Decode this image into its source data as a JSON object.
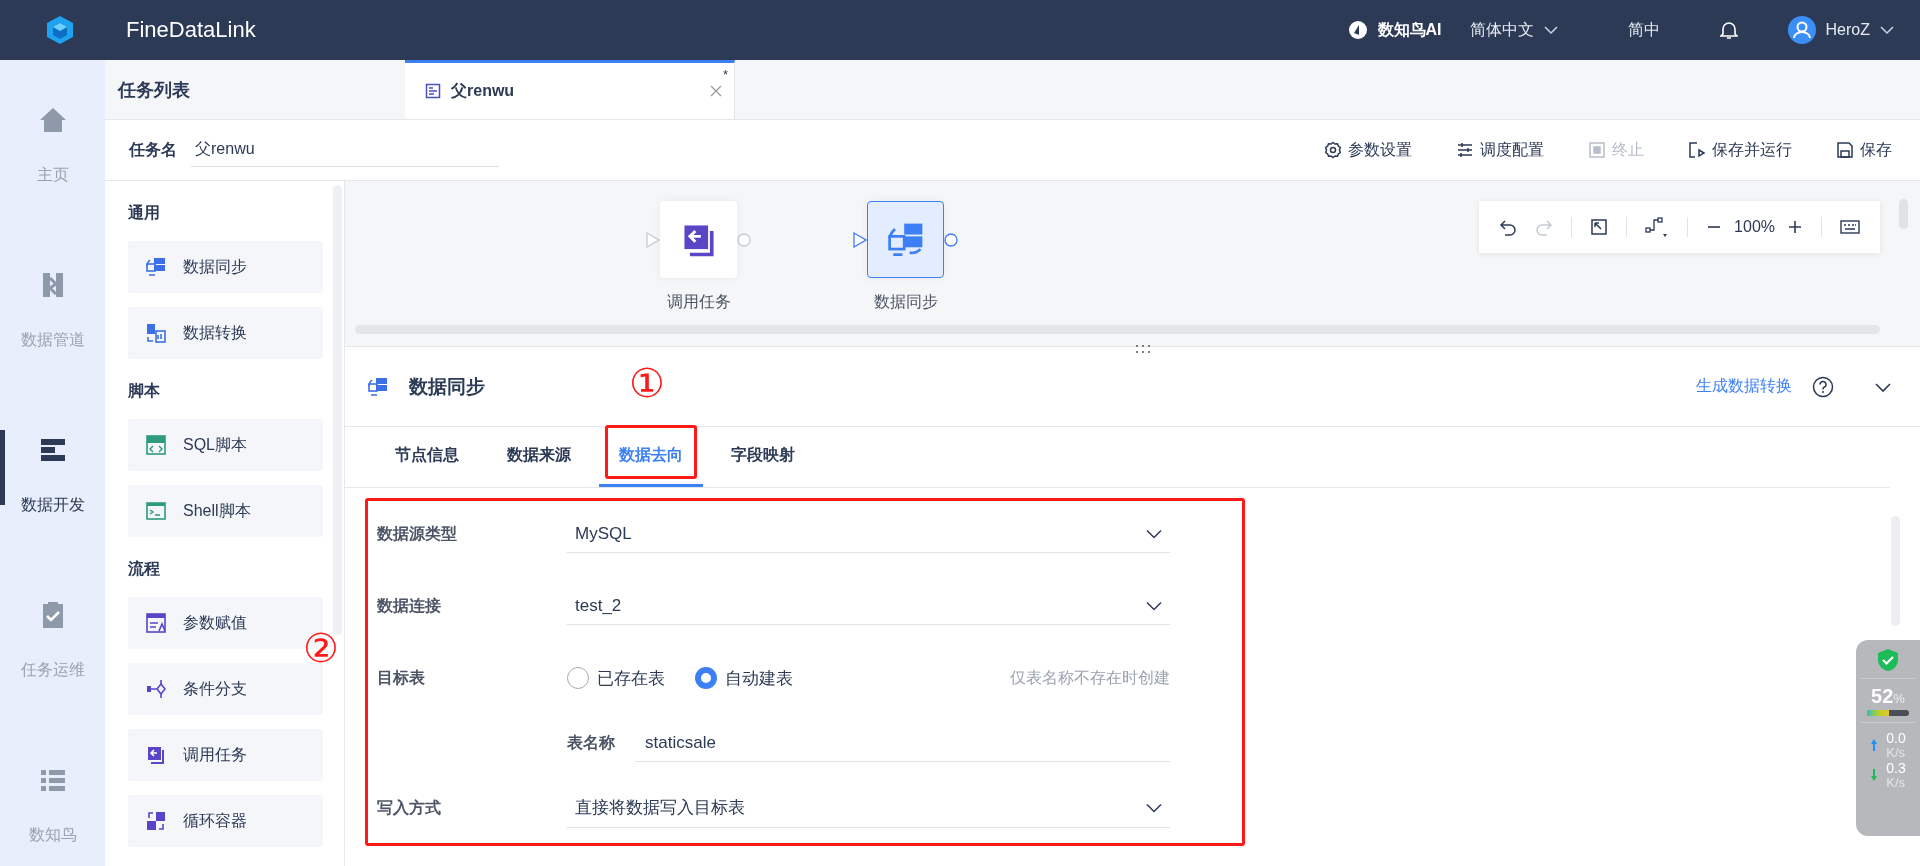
{
  "header": {
    "brand": "FineDataLink",
    "ai_label": "数知鸟AI",
    "language": "简体中文",
    "short_language": "简中",
    "user": "HeroZ"
  },
  "nav": [
    {
      "label": "主页",
      "kind": "home",
      "selected": false
    },
    {
      "label": "数据管道",
      "kind": "pipe",
      "selected": false
    },
    {
      "label": "数据开发",
      "kind": "dev",
      "selected": true
    },
    {
      "label": "任务运维",
      "kind": "ops",
      "selected": false
    },
    {
      "label": "数知鸟",
      "kind": "list",
      "selected": false
    }
  ],
  "task_list_title": "任务列表",
  "tabs": [
    {
      "label": "父renwu",
      "modified": "*",
      "selected": true
    }
  ],
  "task_name": {
    "label": "任务名",
    "value": "父renwu"
  },
  "toolbar": [
    {
      "label": "参数设置",
      "kind": "gear",
      "disabled": false
    },
    {
      "label": "调度配置",
      "kind": "sliders",
      "disabled": false
    },
    {
      "label": "终止",
      "kind": "stop",
      "disabled": true
    },
    {
      "label": "保存并运行",
      "kind": "run",
      "disabled": false
    },
    {
      "label": "保存",
      "kind": "save",
      "disabled": false
    }
  ],
  "palette": [
    {
      "group": "通用",
      "items": [
        {
          "label": "数据同步",
          "kind": "sync"
        },
        {
          "label": "数据转换",
          "kind": "transform"
        }
      ]
    },
    {
      "group": "脚本",
      "items": [
        {
          "label": "SQL脚本",
          "kind": "sql"
        },
        {
          "label": "Shell脚本",
          "kind": "shell"
        }
      ]
    },
    {
      "group": "流程",
      "items": [
        {
          "label": "参数赋值",
          "kind": "param"
        },
        {
          "label": "条件分支",
          "kind": "branch"
        },
        {
          "label": "调用任务",
          "kind": "call"
        },
        {
          "label": "循环容器",
          "kind": "loop"
        }
      ]
    }
  ],
  "canvas": {
    "nodes": [
      {
        "label": "调用任务",
        "kind": "call",
        "selected": false
      },
      {
        "label": "数据同步",
        "kind": "sync",
        "selected": true
      }
    ],
    "zoom": "100%"
  },
  "detail": {
    "title": "数据同步",
    "action_link": "生成数据转换",
    "tabs": [
      {
        "label": "节点信息",
        "selected": false
      },
      {
        "label": "数据来源",
        "selected": false
      },
      {
        "label": "数据去向",
        "selected": true
      },
      {
        "label": "字段映射",
        "selected": false
      }
    ],
    "form": [
      {
        "kind": "select",
        "label": "数据源类型",
        "value": "MySQL"
      },
      {
        "kind": "select",
        "label": "数据连接",
        "value": "test_2"
      },
      {
        "kind": "radio",
        "label": "目标表",
        "options": [
          {
            "label": "已存在表",
            "selected": false
          },
          {
            "label": "自动建表",
            "selected": true
          }
        ],
        "hint": "仅表名称不存在时创建"
      },
      {
        "kind": "subinput",
        "label": "表名称",
        "value": "staticsale"
      },
      {
        "kind": "select",
        "label": "写入方式",
        "value": "直接将数据写入目标表"
      }
    ]
  },
  "annotations": {
    "tab_mark": "①",
    "form_mark": "②"
  },
  "monitor": {
    "percent": "52",
    "unit": "%",
    "level": 0.52,
    "upload": "0.0",
    "upload_unit": "K/s",
    "download": "0.3",
    "download_unit": "K/s"
  }
}
